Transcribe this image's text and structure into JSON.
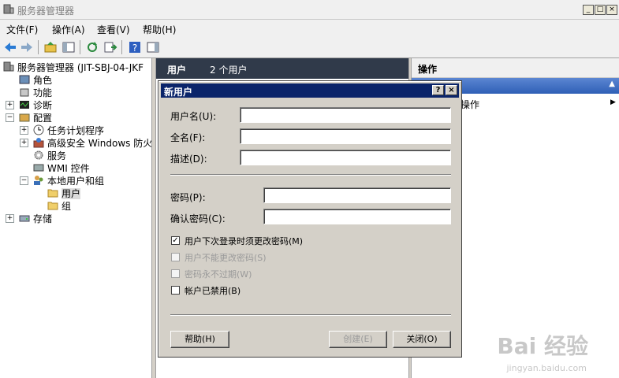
{
  "window": {
    "title": "服务器管理器"
  },
  "menu": [
    "文件(F)",
    "操作(A)",
    "查看(V)",
    "帮助(H)"
  ],
  "tree": {
    "root": "服务器管理器 (JIT-SBJ-04-JKF",
    "items": [
      "角色",
      "功能",
      "诊断",
      "配置",
      "任务计划程序",
      "高级安全 Windows 防火墙",
      "服务",
      "WMI 控件",
      "本地用户和组",
      "用户",
      "组",
      "存储"
    ]
  },
  "middle": {
    "header_title": "用户",
    "header_count": "2 个用户"
  },
  "actions": {
    "header": "操作",
    "item": "操作"
  },
  "dialog": {
    "title": "新用户",
    "help_glyph": "?",
    "close_glyph": "×",
    "labels": {
      "username": "用户名(U):",
      "fullname": "全名(F):",
      "description": "描述(D):",
      "password": "密码(P):",
      "confirm": "确认密码(C):"
    },
    "values": {
      "username": "",
      "fullname": "",
      "description": "",
      "password": "",
      "confirm": ""
    },
    "checkboxes": [
      {
        "label": "用户下次登录时须更改密码(M)",
        "checked": true,
        "enabled": true
      },
      {
        "label": "用户不能更改密码(S)",
        "checked": false,
        "enabled": false
      },
      {
        "label": "密码永不过期(W)",
        "checked": false,
        "enabled": false
      },
      {
        "label": "帐户已禁用(B)",
        "checked": false,
        "enabled": true
      }
    ],
    "buttons": {
      "help": "帮助(H)",
      "create": "创建(E)",
      "close": "关闭(O)"
    }
  },
  "watermark": {
    "brand": "Bai 经验",
    "url": "jingyan.baidu.com"
  }
}
